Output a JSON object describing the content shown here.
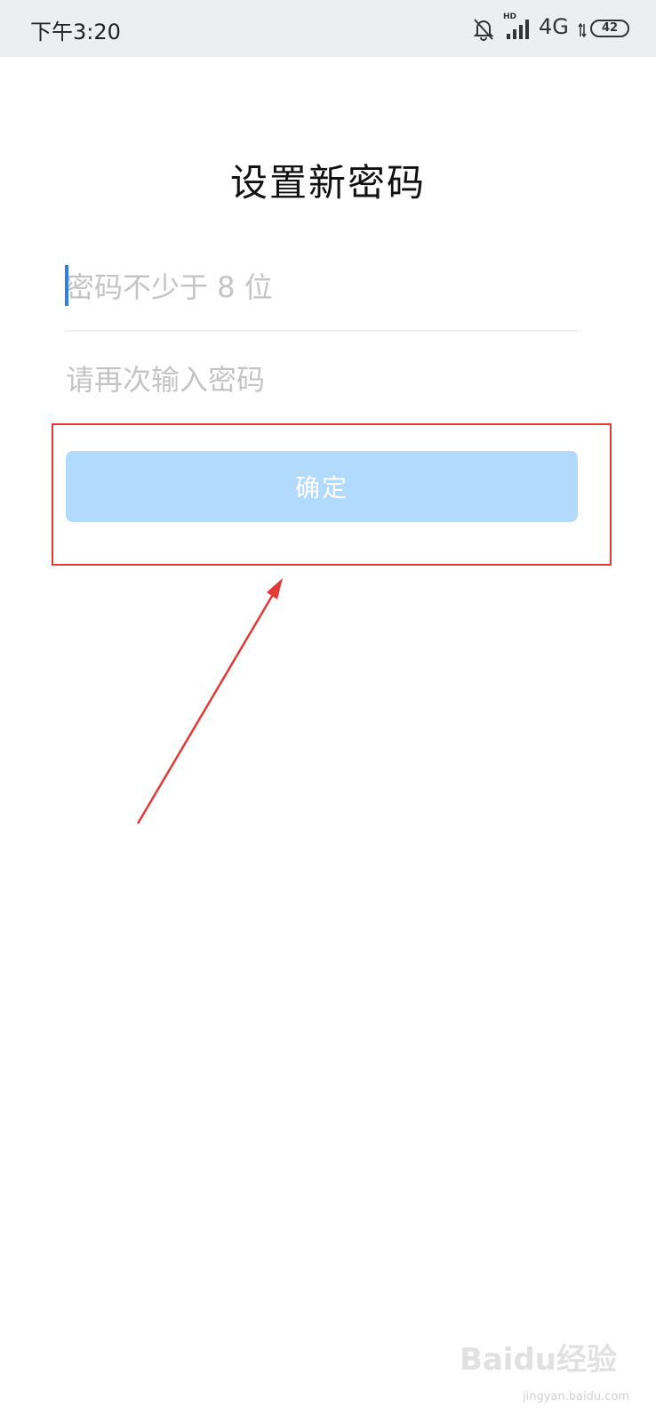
{
  "status_bar": {
    "time": "下午3:20",
    "hd": "HD",
    "network": "4G",
    "battery": "42",
    "icons": [
      "mute-bell-icon",
      "signal-bars-icon",
      "data-arrows-icon",
      "battery-icon"
    ]
  },
  "page": {
    "title": "设置新密码"
  },
  "form": {
    "password_placeholder": "密码不少于 8 位",
    "password_value": "",
    "confirm_placeholder": "请再次输入密码",
    "confirm_value": "",
    "submit_label": "确定"
  },
  "annotation": {
    "color": "#e53935"
  },
  "colors": {
    "button_bg": "#b2dafc",
    "caret": "#2f80e6"
  },
  "watermark": {
    "main": "Baidu经验",
    "sub": "jingyan.baidu.com"
  }
}
